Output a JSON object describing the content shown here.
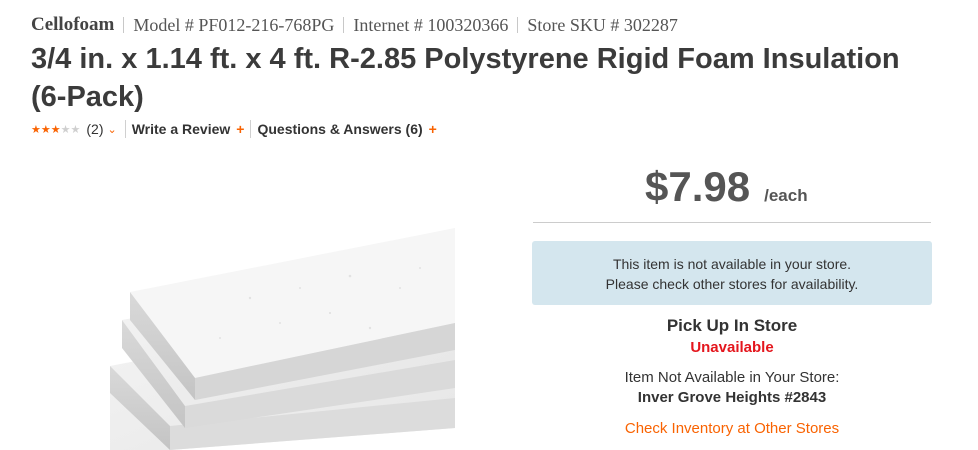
{
  "product": {
    "brand": "Cellofoam",
    "model": "Model # PF012-216-768PG",
    "internet": "Internet # 100320366",
    "store_sku": "Store SKU # 302287",
    "title": "3/4 in. x 1.14 ft. x 4 ft. R-2.85 Polystyrene Rigid Foam Insulation (6-Pack)"
  },
  "rating": {
    "stars_filled": 3,
    "stars_total": 5,
    "count": "(2)",
    "write_review": "Write a Review",
    "qa": "Questions & Answers (6)"
  },
  "pricing": {
    "price": "$7.98",
    "unit": "/each"
  },
  "availability": {
    "notice_line1": "This item is not available in your store.",
    "notice_line2": "Please check other stores for availability.",
    "pickup_title": "Pick Up In Store",
    "pickup_status": "Unavailable",
    "not_available_note": "Item Not Available in Your Store:",
    "store_name": "Inver Grove Heights #2843",
    "check_link": "Check Inventory at Other Stores"
  },
  "colors": {
    "accent": "#f96302",
    "unavailable": "#e4161d",
    "notice_bg": "#d4e6ee"
  }
}
